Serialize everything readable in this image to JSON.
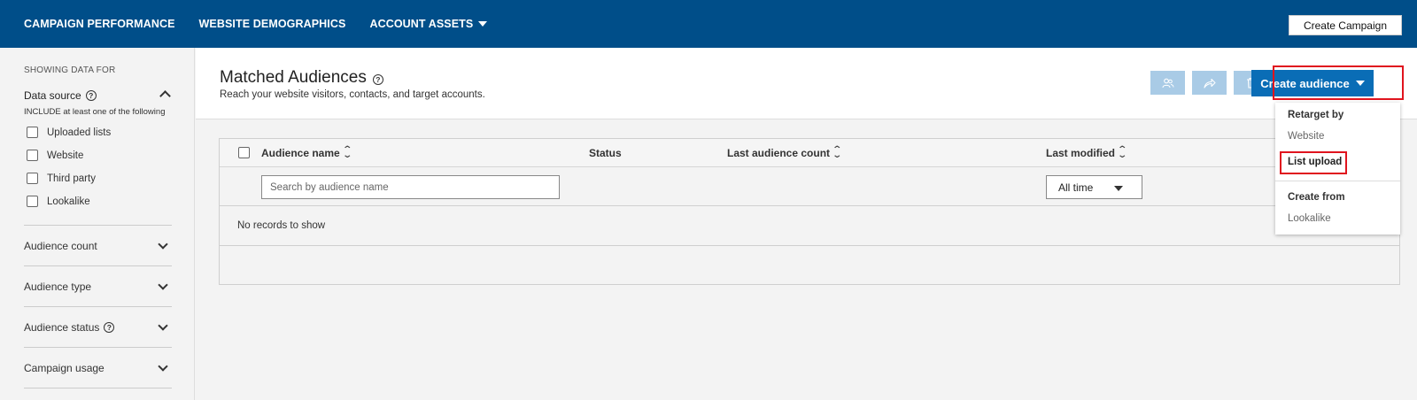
{
  "topnav": {
    "items": [
      {
        "label": "CAMPAIGN PERFORMANCE"
      },
      {
        "label": "WEBSITE DEMOGRAPHICS"
      },
      {
        "label": "ACCOUNT ASSETS"
      }
    ],
    "create_campaign_label": "Create Campaign"
  },
  "sidebar": {
    "showing_label": "SHOWING DATA FOR",
    "data_source": {
      "title": "Data source",
      "hint": "INCLUDE at least one of the following",
      "options": [
        "Uploaded lists",
        "Website",
        "Third party",
        "Lookalike"
      ]
    },
    "filters": [
      "Audience count",
      "Audience type",
      "Audience status",
      "Campaign usage"
    ]
  },
  "header": {
    "title": "Matched Audiences",
    "subtitle": "Reach your website visitors, contacts, and target accounts.",
    "create_audience_label": "Create audience",
    "tool_icons": [
      "users-icon",
      "share-icon",
      "trash-icon"
    ]
  },
  "table": {
    "columns": [
      "Audience name",
      "Status",
      "Last audience count",
      "Last modified"
    ],
    "search_placeholder": "Search by audience name",
    "date_filter_value": "All time",
    "empty_message": "No records to show"
  },
  "dropdown": {
    "retarget_heading": "Retarget by",
    "website_item": "Website",
    "list_upload_item": "List upload",
    "create_from_heading": "Create from",
    "lookalike_item": "Lookalike"
  },
  "colors": {
    "nav_bg": "#004e89",
    "primary": "#0a6db6",
    "highlight": "#e0141e"
  }
}
